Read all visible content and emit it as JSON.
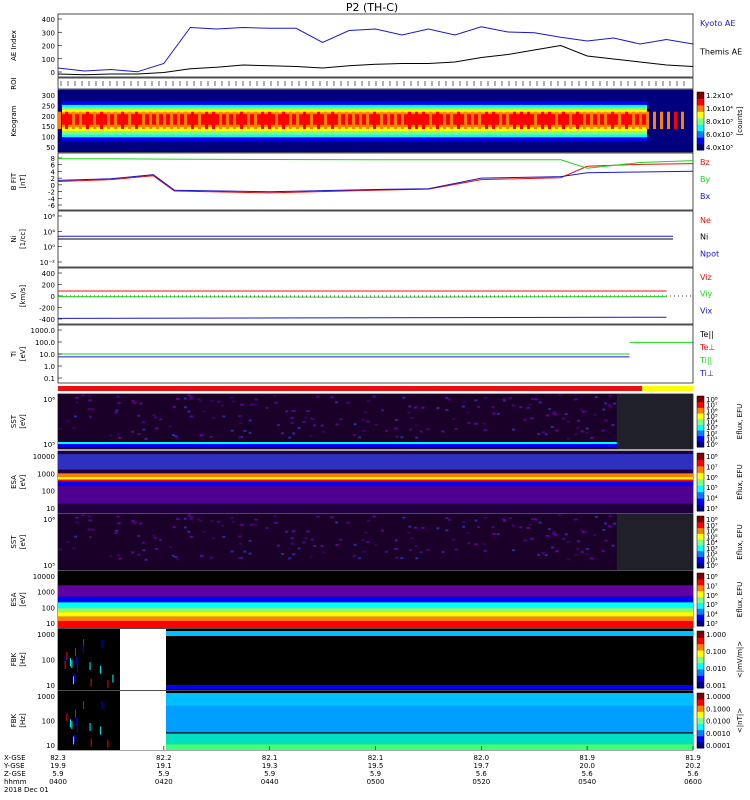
{
  "title": "P2 (TH-C)",
  "colors": {
    "red": "#e81010",
    "green": "#18d818",
    "blue": "#1818c8",
    "black": "#000000",
    "purple": "#8000b0"
  },
  "panels": [
    {
      "id": "ae",
      "ylabel": "AE Index",
      "unit": "",
      "ticks": [
        "400",
        "300",
        "200",
        "100",
        "0"
      ],
      "legend": [
        {
          "text": "Kyoto AE",
          "color": "#1818c8"
        },
        {
          "text": "Themis AE",
          "color": "#000000"
        }
      ]
    },
    {
      "id": "roi",
      "ylabel": "ROI",
      "unit": "",
      "ticks": [],
      "legend": []
    },
    {
      "id": "kp",
      "ylabel": "Keogram",
      "unit": "",
      "ticks": [
        "300",
        "250",
        "200",
        "150",
        "100",
        "50"
      ],
      "cbar": {
        "labels": [
          "1.2x10⁴",
          "1.0x10⁴",
          "8.0x10³",
          "6.0x10³",
          "4.0x10³"
        ],
        "title": "[counts]"
      },
      "legend": []
    },
    {
      "id": "bfit",
      "ylabel": "B FIT",
      "unit": "[nT]",
      "ticks": [
        "8",
        "6",
        "4",
        "2",
        "0",
        "-2",
        "-4",
        "-6"
      ],
      "legend": [
        {
          "text": "Bz",
          "color": "#e81010"
        },
        {
          "text": "By",
          "color": "#18d818"
        },
        {
          "text": "Bx",
          "color": "#1818c8"
        }
      ]
    },
    {
      "id": "ni",
      "ylabel": "Ni",
      "unit": "[1/cc]",
      "ticks": [
        "10⁶",
        "10⁴",
        "10⁰",
        "10⁻²"
      ],
      "legend": [
        {
          "text": "Ne",
          "color": "#e81010"
        },
        {
          "text": "Ni",
          "color": "#000000"
        },
        {
          "text": "Npot",
          "color": "#1818c8"
        }
      ]
    },
    {
      "id": "vi",
      "ylabel": "Vi",
      "unit": "[km/s]",
      "ticks": [
        "400",
        "200",
        "0",
        "-200",
        "-400"
      ],
      "legend": [
        {
          "text": "Viz",
          "color": "#e81010"
        },
        {
          "text": "Viy",
          "color": "#18d818"
        },
        {
          "text": "Vix",
          "color": "#1818c8"
        }
      ]
    },
    {
      "id": "ti",
      "ylabel": "Ti",
      "unit": "[eV]",
      "ticks": [
        "1000.0",
        "100.0",
        "10.0",
        "1.0",
        "0.1"
      ],
      "legend": [
        {
          "text": "Te||",
          "color": "#000000"
        },
        {
          "text": "Te⊥",
          "color": "#e81010"
        },
        {
          "text": "Ti||",
          "color": "#18d818"
        },
        {
          "text": "Ti⊥",
          "color": "#1818c8"
        }
      ]
    },
    {
      "id": "sst1",
      "ylabel": "SST",
      "unit": "[eV]",
      "ticks": [
        "10⁶",
        "10⁵"
      ],
      "cbar": {
        "labels": [
          "10⁸",
          "10⁷",
          "10⁶",
          "10⁵",
          "10⁴",
          "10³",
          "10²",
          "10¹",
          "10⁰"
        ],
        "title": "Eflux, EFU"
      },
      "legend": []
    },
    {
      "id": "esa1",
      "ylabel": "ESA",
      "unit": "[eV]",
      "ticks": [
        "10000",
        "1000",
        "100",
        "10"
      ],
      "cbar": {
        "labels": [
          "10⁸",
          "10⁷",
          "10⁶",
          "10⁵",
          "10⁴",
          "10³"
        ],
        "title": "Eflux, EFU"
      },
      "legend": []
    },
    {
      "id": "sst2",
      "ylabel": "SST",
      "unit": "[eV]",
      "ticks": [
        "10⁶",
        "10⁵"
      ],
      "cbar": {
        "labels": [
          "10⁸",
          "10⁷",
          "10⁶",
          "10⁵",
          "10⁴",
          "10³",
          "10²",
          "10¹",
          "10⁰"
        ],
        "title": "Eflux, EFU"
      },
      "legend": []
    },
    {
      "id": "esa2",
      "ylabel": "ESA",
      "unit": "[eV]",
      "ticks": [
        "10000",
        "1000",
        "100",
        "10"
      ],
      "cbar": {
        "labels": [
          "10⁸",
          "10⁷",
          "10⁶",
          "10⁵",
          "10⁴",
          "10³"
        ],
        "title": "Eflux, EFU"
      },
      "legend": []
    },
    {
      "id": "fbk1",
      "ylabel": "FBK",
      "unit": "[Hz]",
      "ticks": [
        "1000",
        "100",
        "10"
      ],
      "cbar": {
        "labels": [
          "1.000",
          "0.100",
          "0.010",
          "0.001"
        ],
        "title": "<|mV/m|>"
      },
      "legend": []
    },
    {
      "id": "fbk2",
      "ylabel": "FBK",
      "unit": "[Hz]",
      "ticks": [
        "1000",
        "100",
        "10"
      ],
      "cbar": {
        "labels": [
          "1.0000",
          "0.1000",
          "0.0100",
          "0.0010",
          "0.0001"
        ],
        "title": "<|nT|>"
      },
      "legend": []
    }
  ],
  "bottom_axis": {
    "row_labels": [
      "X-GSE",
      "Y-GSE",
      "Z-GSE",
      "hhmm",
      "2018 Dec 01"
    ],
    "columns": [
      [
        "82.3",
        "19.9",
        "5.9",
        "0400"
      ],
      [
        "82.2",
        "19.1",
        "5.9",
        "0420"
      ],
      [
        "82.1",
        "19.3",
        "5.9",
        "0440"
      ],
      [
        "82.1",
        "19.5",
        "5.9",
        "0500"
      ],
      [
        "82.0",
        "19.7",
        "5.6",
        "0520"
      ],
      [
        "81.9",
        "20.0",
        "5.6",
        "0540"
      ],
      [
        "81.9",
        "20.2",
        "5.6",
        "0600"
      ]
    ]
  },
  "chart_data": {
    "type": "line",
    "title": "P2 (TH-C)",
    "x_label": "hhmm",
    "date": "2018 Dec 01",
    "x_range": [
      "0400",
      "0600"
    ],
    "series": [
      {
        "name": "Kyoto AE",
        "panel": "ae",
        "x": [
          "0400",
          "0405",
          "0410",
          "0415",
          "0420",
          "0425",
          "0430",
          "0435",
          "0440",
          "0445",
          "0450",
          "0455",
          "0500",
          "0505",
          "0510",
          "0515",
          "0520",
          "0525",
          "0530",
          "0535",
          "0540",
          "0545",
          "0550",
          "0555",
          "0600"
        ],
        "values": [
          60,
          40,
          50,
          35,
          90,
          330,
          320,
          330,
          325,
          325,
          230,
          310,
          320,
          280,
          320,
          280,
          335,
          300,
          295,
          265,
          240,
          260,
          220,
          250,
          220
        ]
      },
      {
        "name": "Themis AE",
        "panel": "ae",
        "x": [
          "0400",
          "0405",
          "0410",
          "0415",
          "0420",
          "0425",
          "0430",
          "0435",
          "0440",
          "0445",
          "0450",
          "0455",
          "0500",
          "0505",
          "0510",
          "0515",
          "0520",
          "0525",
          "0530",
          "0535",
          "0540",
          "0545",
          "0550",
          "0555",
          "0600"
        ],
        "values": [
          20,
          15,
          20,
          20,
          30,
          55,
          65,
          80,
          75,
          70,
          60,
          75,
          85,
          90,
          90,
          100,
          130,
          150,
          180,
          210,
          140,
          120,
          100,
          80,
          70
        ]
      },
      {
        "name": "Bz",
        "panel": "bfit",
        "x": [
          "0400",
          "0410",
          "0418",
          "0422",
          "0440",
          "0500",
          "0510",
          "0520",
          "0535",
          "0540",
          "0550",
          "0600"
        ],
        "values": [
          0.5,
          1.0,
          2.0,
          -2.0,
          -2.5,
          -1.8,
          -1.5,
          1.0,
          1.5,
          4.5,
          5.0,
          5.2
        ]
      },
      {
        "name": "By",
        "panel": "bfit",
        "x": [
          "0400",
          "0410",
          "0420",
          "0440",
          "0500",
          "0520",
          "0535",
          "0540",
          "0550",
          "0600"
        ],
        "values": [
          6.5,
          6.5,
          6.4,
          6.3,
          6.2,
          6.2,
          6.2,
          4.0,
          5.5,
          6.0
        ]
      },
      {
        "name": "Bx",
        "panel": "bfit",
        "x": [
          "0400",
          "0410",
          "0418",
          "0422",
          "0440",
          "0500",
          "0510",
          "0520",
          "0535",
          "0540",
          "0550",
          "0600"
        ],
        "values": [
          0.8,
          1.2,
          2.3,
          -1.8,
          -2.2,
          -1.6,
          -1.4,
          1.4,
          1.8,
          2.8,
          3.0,
          3.2
        ]
      },
      {
        "name": "Viy",
        "panel": "vi",
        "x": [
          "0400",
          "0500",
          "0555"
        ],
        "values": [
          -10,
          -20,
          -10
        ]
      },
      {
        "name": "Viz",
        "panel": "vi",
        "x": [
          "0400",
          "0500",
          "0555"
        ],
        "values": [
          80,
          80,
          80
        ]
      },
      {
        "name": "Vix",
        "panel": "vi",
        "x": [
          "0400",
          "0500",
          "0555"
        ],
        "values": [
          -360,
          -350,
          -340
        ]
      }
    ]
  }
}
